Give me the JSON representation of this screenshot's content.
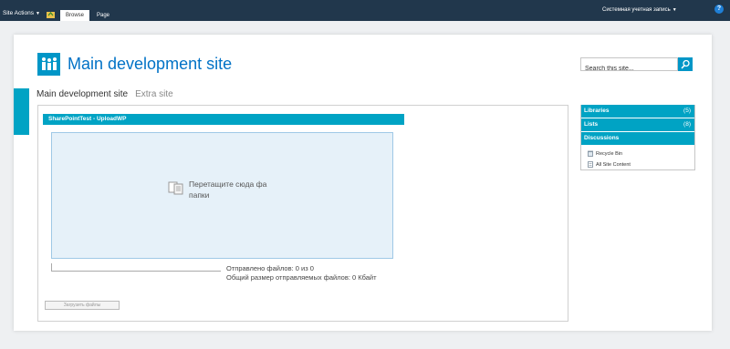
{
  "ribbon": {
    "site_actions": "Site Actions",
    "tabs": [
      {
        "label": "Browse",
        "selected": true
      },
      {
        "label": "Page",
        "selected": false
      }
    ],
    "user": "Системная учетная запись",
    "help_icon": "question-icon"
  },
  "header": {
    "title": "Main development site",
    "logo_icon": "site-logo-people-icon",
    "search": {
      "placeholder": "Search this site...",
      "icon": "search-icon"
    }
  },
  "topnav": {
    "items": [
      {
        "label": "Main development site",
        "selected": true
      },
      {
        "label": "Extra site",
        "selected": false
      }
    ]
  },
  "webpart": {
    "title": "SharePointTest - UploadWP",
    "drop_text_line1": "Перетащите сюда фа",
    "drop_text_line2": "папки",
    "sent_files": "Отправлено файлов: 0 из 0",
    "total_size": "Общий размер отправляемых файлов: 0 Кбайт",
    "upload_button": "Загрузить файлы"
  },
  "sidebar": {
    "libraries": {
      "label": "Libraries",
      "count": "(5)"
    },
    "lists": {
      "label": "Lists",
      "count": "(8)"
    },
    "discussions": {
      "label": "Discussions"
    },
    "links": [
      {
        "label": "Recycle Bin",
        "icon": "recycle-bin-icon"
      },
      {
        "label": "All Site Content",
        "icon": "all-site-content-icon"
      }
    ]
  },
  "colors": {
    "ribbon": "#21374c",
    "accent": "#00a3c4",
    "title": "#0072c6"
  }
}
